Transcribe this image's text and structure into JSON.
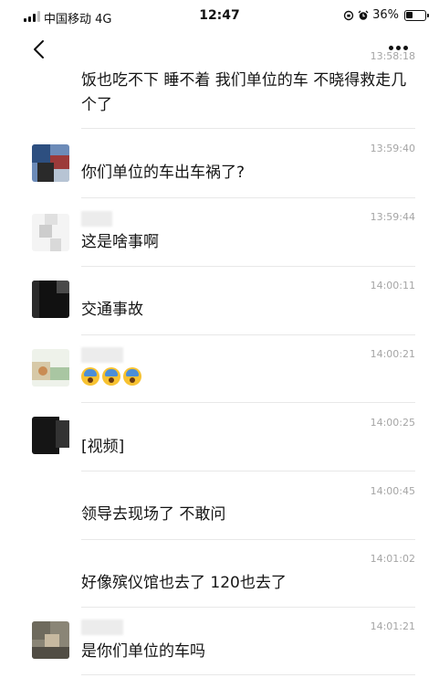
{
  "status_bar": {
    "carrier": "中国移动  4G",
    "time": "12:47",
    "battery": "36%",
    "battery_level": 0.36
  },
  "messages": [
    {
      "time": "13:58:18",
      "text": "饭也吃不下 睡不着 我们单位的车  不晓得救走几个了"
    },
    {
      "time": "13:59:40",
      "text": "你们单位的车出车祸了?"
    },
    {
      "time": "13:59:44",
      "text": "这是啥事啊"
    },
    {
      "time": "14:00:11",
      "text": "交通事故"
    },
    {
      "time": "14:00:21",
      "text": "",
      "emoji_count": 3,
      "emoji_icon": "screaming-face-icon"
    },
    {
      "time": "14:00:25",
      "text": "[视频]"
    },
    {
      "time": "14:00:45",
      "text": "领导去现场了 不敢问"
    },
    {
      "time": "14:01:02",
      "text": "好像殡仪馆也去了 120也去了"
    },
    {
      "time": "14:01:21",
      "text": "是你们单位的车吗"
    }
  ]
}
